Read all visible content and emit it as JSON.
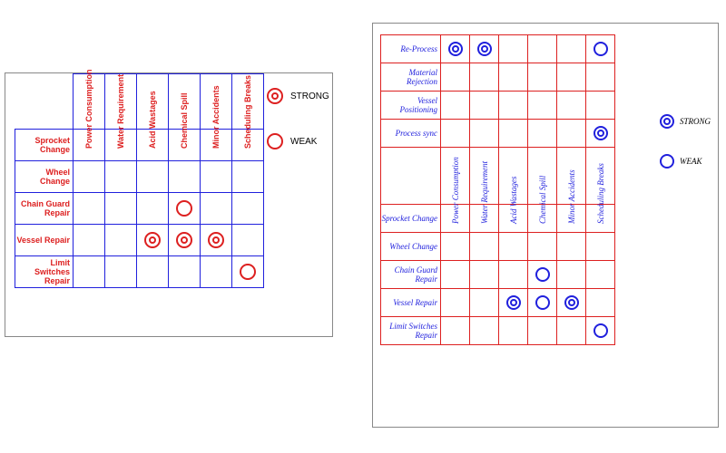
{
  "legend": {
    "strong": "STRONG",
    "weak": "WEAK"
  },
  "left": {
    "cols": [
      "Power Consumption",
      "Water Requirement",
      "Acid Wastages",
      "Chemical Spill",
      "Minor Accidents",
      "Scheduling Breaks"
    ],
    "rows": [
      "Sprocket Change",
      "Wheel Change",
      "Chain Guard Repair",
      "Vessel Repair",
      "Limit Switches Repair"
    ],
    "marks": [
      {
        "r": 2,
        "c": 3,
        "t": "weak"
      },
      {
        "r": 3,
        "c": 2,
        "t": "strong"
      },
      {
        "r": 3,
        "c": 3,
        "t": "strong"
      },
      {
        "r": 3,
        "c": 4,
        "t": "strong"
      },
      {
        "r": 4,
        "c": 5,
        "t": "weak"
      }
    ]
  },
  "right": {
    "topRows": [
      "Re-Process",
      "Material Rejection",
      "Vessel Positioning",
      "Process sync"
    ],
    "cols": [
      "Power Consumption",
      "Water Requirement",
      "Acid Wastages",
      "Chemical Spill",
      "Minor Accidents",
      "Scheduling Breaks"
    ],
    "bottomRows": [
      "Sprocket Change",
      "Wheel Change",
      "Chain Guard Repair",
      "Vessel Repair",
      "Limit Switches Repair"
    ],
    "topMarks": [
      {
        "r": 0,
        "c": 0,
        "t": "strong"
      },
      {
        "r": 0,
        "c": 1,
        "t": "strong"
      },
      {
        "r": 0,
        "c": 5,
        "t": "weak"
      },
      {
        "r": 3,
        "c": 5,
        "t": "strong"
      }
    ],
    "bottomMarks": [
      {
        "r": 2,
        "c": 3,
        "t": "weak"
      },
      {
        "r": 3,
        "c": 2,
        "t": "strong"
      },
      {
        "r": 3,
        "c": 3,
        "t": "weak"
      },
      {
        "r": 3,
        "c": 4,
        "t": "strong"
      },
      {
        "r": 4,
        "c": 5,
        "t": "weak"
      }
    ]
  }
}
